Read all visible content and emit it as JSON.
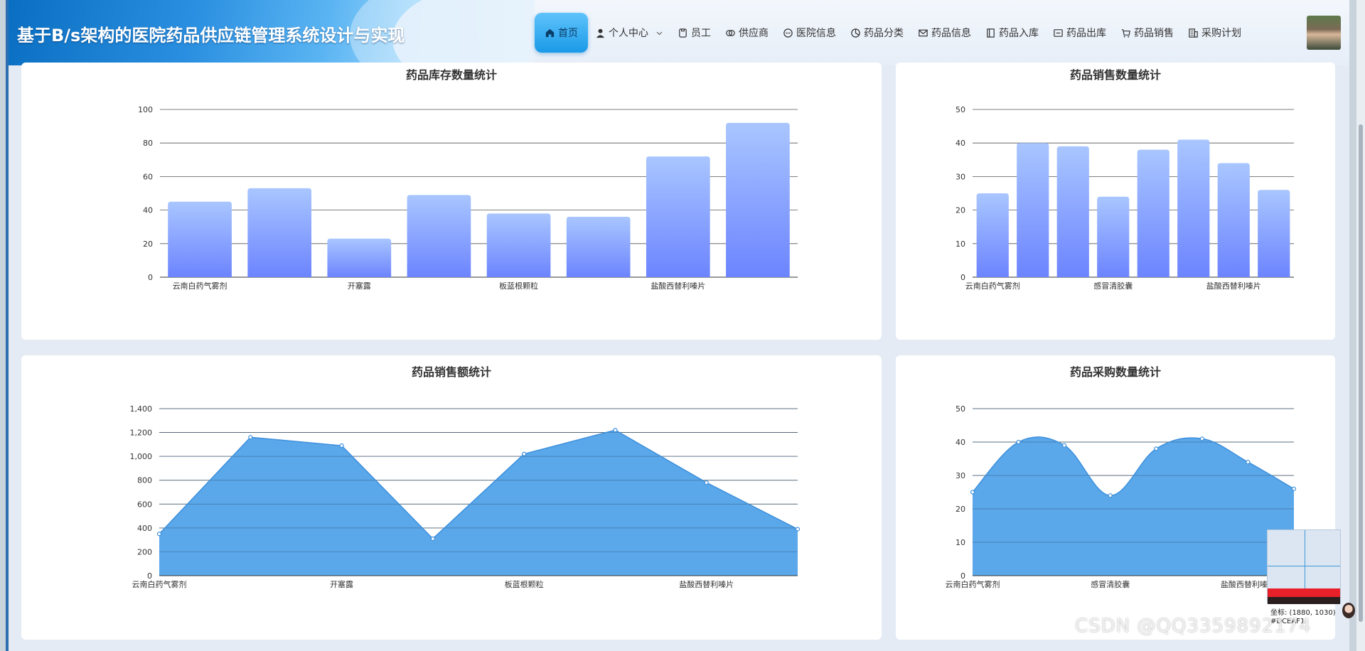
{
  "header": {
    "app_title": "基于B/s架构的医院药品供应链管理系统设计与实现"
  },
  "nav": {
    "items": [
      {
        "label": "首页",
        "icon": "home-icon",
        "active": true
      },
      {
        "label": "个人中心",
        "icon": "user-icon",
        "dropdown": true
      },
      {
        "label": "员工",
        "icon": "staff-icon"
      },
      {
        "label": "供应商",
        "icon": "supplier-icon"
      },
      {
        "label": "医院信息",
        "icon": "chat-icon"
      },
      {
        "label": "药品分类",
        "icon": "pie-icon"
      },
      {
        "label": "药品信息",
        "icon": "mail-icon"
      },
      {
        "label": "药品入库",
        "icon": "book-icon"
      },
      {
        "label": "药品出库",
        "icon": "box-icon"
      },
      {
        "label": "药品销售",
        "icon": "cart-icon"
      },
      {
        "label": "采购计划",
        "icon": "building-icon"
      }
    ]
  },
  "colors": {
    "bar_top": "#a9c6ff",
    "bar_bottom": "#6c84ff",
    "area_fill": "#5aa8ea",
    "area_line": "#3d8fdc"
  },
  "chart_data": [
    {
      "id": "stock",
      "type": "bar",
      "title": "药品库存数量统计",
      "categories": [
        "云南白药气雾剂",
        "",
        "开塞露",
        "",
        "板蓝根颗粒",
        "",
        "盐酸西替利嗪片",
        ""
      ],
      "values": [
        45,
        53,
        23,
        49,
        38,
        36,
        72,
        92
      ],
      "ylim": [
        0,
        100
      ],
      "yticks": [
        0,
        20,
        40,
        60,
        80,
        100
      ],
      "grid": true
    },
    {
      "id": "sales_qty",
      "type": "bar",
      "title": "药品销售数量统计",
      "categories": [
        "云南白药气雾剂",
        "",
        "",
        "感冒清胶囊",
        "",
        "",
        "盐酸西替利嗪片",
        ""
      ],
      "values": [
        25,
        40,
        39,
        24,
        38,
        41,
        34,
        26
      ],
      "ylim": [
        0,
        50
      ],
      "yticks": [
        0,
        10,
        20,
        30,
        40,
        50
      ],
      "grid": true
    },
    {
      "id": "sales_amount",
      "type": "area",
      "title": "药品销售额统计",
      "categories": [
        "云南白药气雾剂",
        "",
        "开塞露",
        "",
        "板蓝根颗粒",
        "",
        "盐酸西替利嗪片",
        ""
      ],
      "values": [
        350,
        1160,
        1090,
        310,
        1020,
        1220,
        780,
        390
      ],
      "ylim": [
        0,
        1400
      ],
      "yticks": [
        "0",
        "200",
        "400",
        "600",
        "800",
        "1,000",
        "1,200",
        "1,400"
      ],
      "smooth": false,
      "grid": true
    },
    {
      "id": "purchase_qty",
      "type": "area",
      "title": "药品采购数量统计",
      "categories": [
        "云南白药气雾剂",
        "",
        "",
        "感冒清胶囊",
        "",
        "",
        "盐酸西替利嗪片",
        ""
      ],
      "values": [
        25,
        40,
        39,
        24,
        38,
        41,
        34,
        26
      ],
      "ylim": [
        0,
        50
      ],
      "yticks": [
        0,
        10,
        20,
        30,
        40,
        50
      ],
      "smooth": true,
      "grid": true
    }
  ],
  "overlay": {
    "coord_text": "坐标: (1880, 1030)",
    "color_text": "#DCEAF1",
    "watermark": "CSDN @QQ3359892174"
  }
}
